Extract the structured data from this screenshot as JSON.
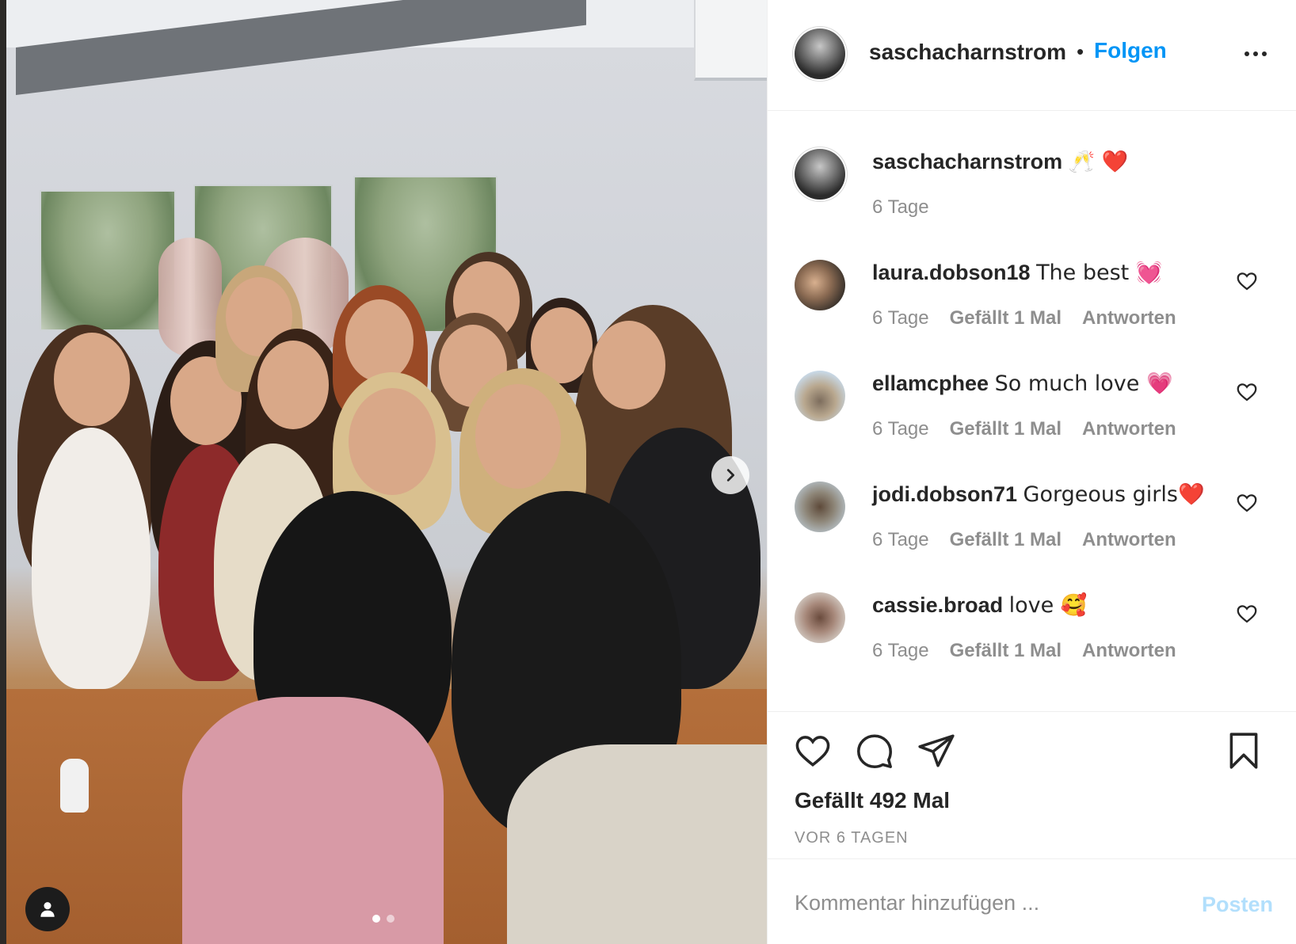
{
  "post": {
    "author": "saschacharnstrom",
    "follow_label": "Folgen",
    "separator": "•",
    "caption_text": "🥂 ❤️",
    "caption_time": "6 Tage",
    "like_count_label": "Gefällt 492 Mal",
    "posted_ago": "VOR 6 TAGEN",
    "carousel": {
      "current": 1,
      "total": 2
    }
  },
  "comments": [
    {
      "user": "laura.dobson18",
      "text": "The best 💓",
      "time": "6 Tage",
      "likes": "Gefällt 1 Mal",
      "reply": "Antworten"
    },
    {
      "user": "ellamcphee",
      "text": "So much love 💗",
      "time": "6 Tage",
      "likes": "Gefällt 1 Mal",
      "reply": "Antworten"
    },
    {
      "user": "jodi.dobson71",
      "text": "Gorgeous girls❤️",
      "time": "6 Tage",
      "likes": "Gefällt 1 Mal",
      "reply": "Antworten"
    },
    {
      "user": "cassie.broad",
      "text": "love 🥰",
      "time": "6 Tage",
      "likes": "Gefällt 1 Mal",
      "reply": "Antworten"
    }
  ],
  "add_comment": {
    "placeholder": "Kommentar hinzufügen ...",
    "post_label": "Posten"
  },
  "icons": {
    "like": "heart-icon",
    "comment": "comment-icon",
    "share": "paper-plane-icon",
    "save": "bookmark-icon",
    "more": "more-dots-icon",
    "next": "chevron-right-icon",
    "tags": "user-tag-icon"
  },
  "colors": {
    "accent": "#0095f6",
    "post_disabled": "#b2dffc",
    "text": "#262626",
    "muted": "#8e8e8e"
  }
}
